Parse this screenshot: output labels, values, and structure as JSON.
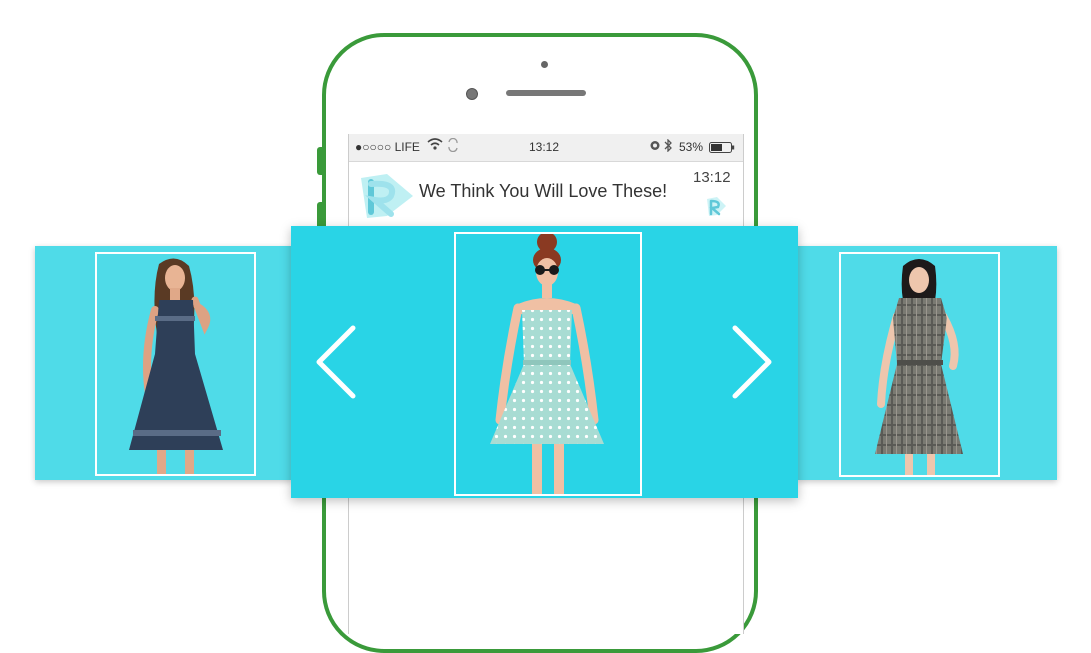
{
  "status_bar": {
    "carrier": "●○○○○ LIFE",
    "time": "13:12",
    "battery": "53%"
  },
  "notification": {
    "message": "We Think You Will Love These!",
    "time": "13:12"
  },
  "carousel": {
    "products": [
      {
        "name": "navy-mesh-dress",
        "dress_color": "#2e3f58"
      },
      {
        "name": "mint-polka-dot-dress",
        "dress_color": "#a8dcd3"
      },
      {
        "name": "grey-plaid-shirt-dress",
        "dress_color": "#7a7a72"
      }
    ],
    "colors": {
      "center_bg": "#29d4e6",
      "side_bg": "#4fdbe8",
      "frame": "#ffffff"
    }
  },
  "colors": {
    "phone_frame": "#3a9a3a"
  }
}
